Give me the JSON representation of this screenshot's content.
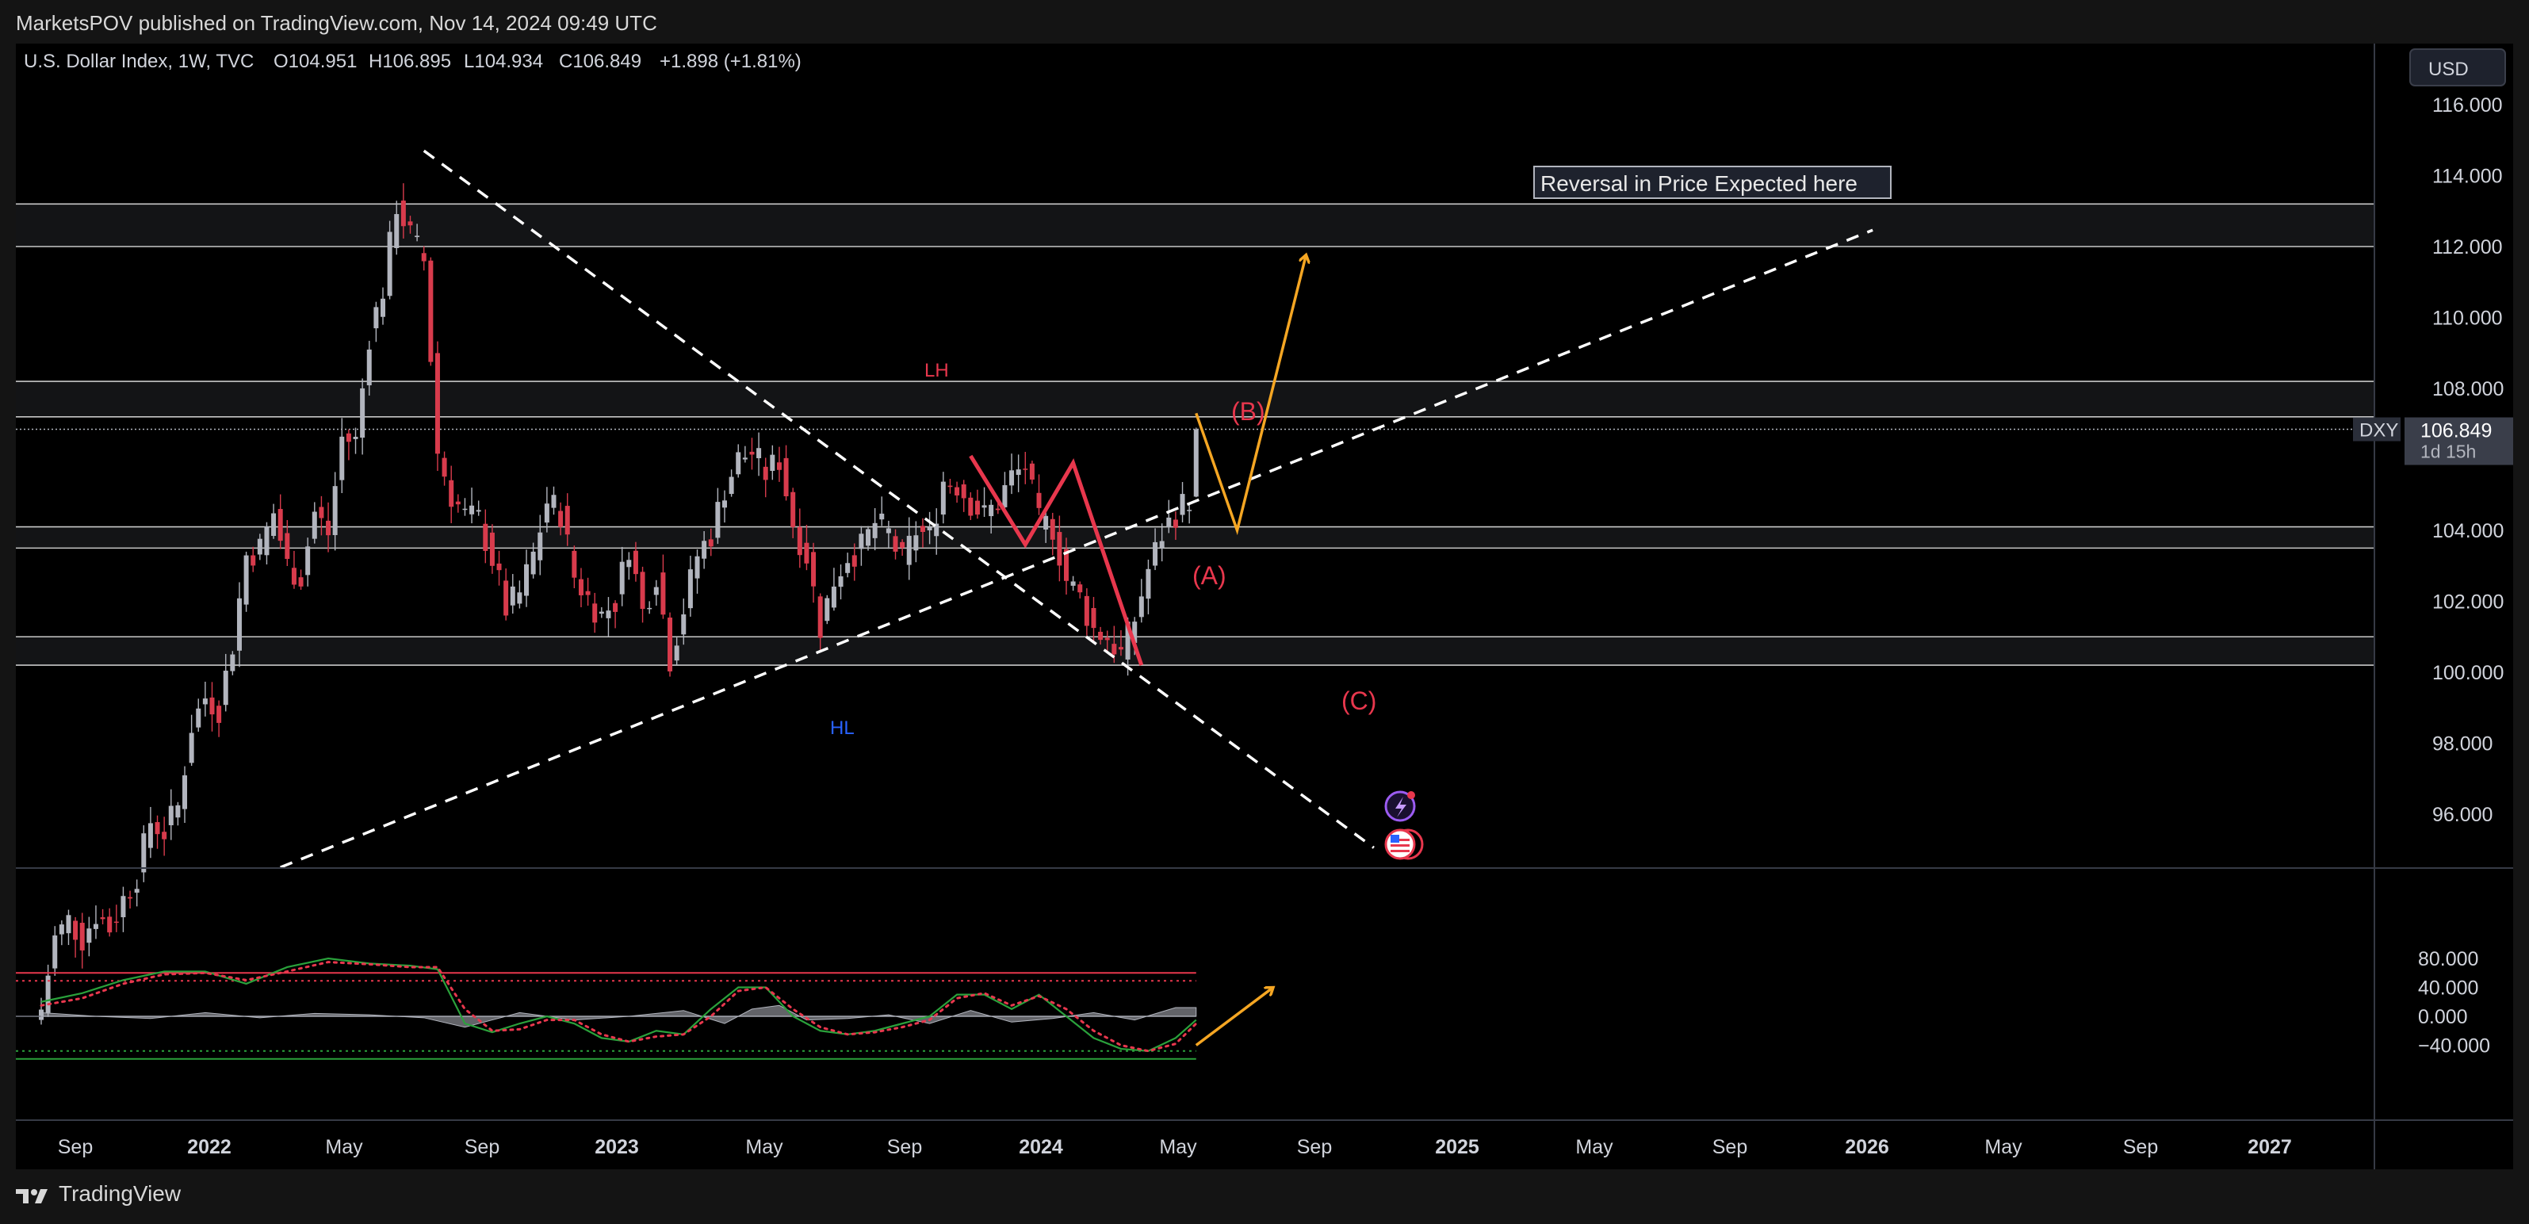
{
  "header": {
    "published": "MarketsPOV published on TradingView.com, Nov 14, 2024 09:49 UTC"
  },
  "legend": {
    "symbol": "U.S. Dollar Index, 1W, TVC",
    "open": "O104.951",
    "high": "H106.895",
    "low": "L104.934",
    "close": "C106.849",
    "change": "+1.898 (+1.81%)"
  },
  "currency": "USD",
  "price_axis": {
    "ticks": [
      "116.000",
      "114.000",
      "112.000",
      "110.000",
      "108.000",
      "104.000",
      "102.000",
      "100.000",
      "98.000",
      "96.000"
    ]
  },
  "price_badge": {
    "ticker": "DXY",
    "price": "106.849",
    "countdown": "1d 15h"
  },
  "osc_axis": {
    "ticks": [
      "80.000",
      "40.000",
      "0.000",
      "−40.000"
    ]
  },
  "time_axis": {
    "labels": [
      "Sep",
      "2022",
      "May",
      "Sep",
      "2023",
      "May",
      "Sep",
      "2024",
      "May",
      "Sep",
      "2025",
      "May",
      "Sep",
      "2026",
      "May",
      "Sep",
      "2027"
    ]
  },
  "annotations": {
    "note": "Reversal in Price Expected here",
    "lh": "LH",
    "hl": "HL",
    "a": "(A)",
    "b": "(B)",
    "c": "(C)"
  },
  "footer": {
    "brand": "TradingView"
  },
  "colors": {
    "bull": "#b2b5be",
    "bear": "#d83b4c",
    "accent": "#f5a623",
    "wave": "#e8374d",
    "trend": "#ffffff"
  },
  "chart_data": {
    "type": "candlestick",
    "title": "U.S. Dollar Index, 1W, TVC",
    "ylim": [
      94.5,
      117
    ],
    "osc_ylim": [
      -52,
      92
    ],
    "close_path": [
      [
        0,
        90.5
      ],
      [
        2,
        92.5
      ],
      [
        4,
        93
      ],
      [
        6,
        92.5
      ],
      [
        8,
        93.2
      ],
      [
        10,
        92.8
      ],
      [
        12,
        93.6
      ],
      [
        14,
        94.3
      ],
      [
        16,
        95.8
      ],
      [
        18,
        95.5
      ],
      [
        20,
        96.2
      ],
      [
        22,
        98.5
      ],
      [
        24,
        99.3
      ],
      [
        26,
        99.0
      ],
      [
        28,
        100.8
      ],
      [
        30,
        103.3
      ],
      [
        32,
        103.5
      ],
      [
        34,
        104.5
      ],
      [
        36,
        103.0
      ],
      [
        38,
        102.7
      ],
      [
        40,
        104.5
      ],
      [
        42,
        103.9
      ],
      [
        44,
        106.6
      ],
      [
        46,
        106.5
      ],
      [
        48,
        109.5
      ],
      [
        50,
        110.8
      ],
      [
        52,
        113.2
      ],
      [
        54,
        112.3
      ],
      [
        56,
        111.6
      ],
      [
        58,
        106.2
      ],
      [
        60,
        105.0
      ],
      [
        62,
        104.4
      ],
      [
        64,
        104.3
      ],
      [
        66,
        103.2
      ],
      [
        68,
        101.8
      ],
      [
        70,
        102.2
      ],
      [
        72,
        103.3
      ],
      [
        74,
        104.8
      ],
      [
        76,
        104.5
      ],
      [
        78,
        102.7
      ],
      [
        80,
        102.1
      ],
      [
        82,
        101.6
      ],
      [
        84,
        102.0
      ],
      [
        86,
        103.6
      ],
      [
        88,
        101.7
      ],
      [
        90,
        102.8
      ],
      [
        92,
        100.4
      ],
      [
        94,
        101.8
      ],
      [
        96,
        103.3
      ],
      [
        98,
        103.9
      ],
      [
        100,
        105.2
      ],
      [
        102,
        106.0
      ],
      [
        104,
        106.2
      ],
      [
        106,
        105.6
      ],
      [
        108,
        106.0
      ],
      [
        110,
        104.2
      ],
      [
        112,
        103.3
      ],
      [
        114,
        101.3
      ],
      [
        116,
        102.6
      ],
      [
        118,
        103.3
      ],
      [
        120,
        103.5
      ],
      [
        122,
        104.2
      ],
      [
        124,
        103.9
      ],
      [
        126,
        103.1
      ],
      [
        128,
        104.0
      ],
      [
        130,
        103.8
      ],
      [
        132,
        105.4
      ],
      [
        134,
        105.3
      ],
      [
        136,
        104.8
      ],
      [
        138,
        104.4
      ],
      [
        140,
        104.8
      ],
      [
        142,
        105.5
      ],
      [
        144,
        105.8
      ],
      [
        146,
        104.2
      ],
      [
        148,
        104.1
      ],
      [
        150,
        102.6
      ],
      [
        152,
        102.1
      ],
      [
        154,
        101.2
      ],
      [
        156,
        101.0
      ],
      [
        158,
        100.5
      ],
      [
        160,
        101.5
      ],
      [
        162,
        102.9
      ],
      [
        164,
        103.9
      ],
      [
        166,
        104.5
      ],
      [
        168,
        104.9
      ],
      [
        169,
        106.849
      ]
    ],
    "zones": [
      [
        112.0,
        113.2
      ],
      [
        107.2,
        108.2
      ],
      [
        103.5,
        104.1
      ],
      [
        100.2,
        101.0
      ]
    ],
    "trendlines": [
      {
        "from": [
          56,
          114.7
        ],
        "to": [
          160,
          100.0
        ],
        "extend_to": 195
      },
      {
        "from": [
          35,
          94.5
        ],
        "to": [
          166,
          104.6
        ],
        "extend_to": 268
      }
    ],
    "current_price": 106.849,
    "ohlc": {
      "open": 104.951,
      "high": 106.895,
      "low": 104.934,
      "close": 106.849,
      "change": 1.898,
      "change_pct": 1.81
    },
    "projection": {
      "arrow": [
        [
          169,
          107.3
        ],
        [
          175,
          104.0
        ],
        [
          185,
          111.7
        ]
      ],
      "osc_arrow": [
        [
          169,
          -40
        ],
        [
          180,
          38
        ]
      ]
    },
    "wave": [
      [
        136,
        106.1
      ],
      [
        144,
        103.6
      ],
      [
        151,
        105.9
      ],
      [
        161,
        100.2
      ]
    ],
    "oscillator": {
      "upper_band": 60,
      "lower_band": -48,
      "fast": [
        [
          0,
          20
        ],
        [
          6,
          32
        ],
        [
          12,
          50
        ],
        [
          18,
          62
        ],
        [
          24,
          62
        ],
        [
          30,
          45
        ],
        [
          36,
          68
        ],
        [
          42,
          80
        ],
        [
          48,
          73
        ],
        [
          54,
          70
        ],
        [
          58,
          65
        ],
        [
          62,
          -10
        ],
        [
          66,
          -22
        ],
        [
          70,
          -10
        ],
        [
          74,
          0
        ],
        [
          78,
          -10
        ],
        [
          82,
          -30
        ],
        [
          86,
          -35
        ],
        [
          90,
          -20
        ],
        [
          94,
          -25
        ],
        [
          98,
          10
        ],
        [
          102,
          40
        ],
        [
          106,
          40
        ],
        [
          110,
          0
        ],
        [
          114,
          -20
        ],
        [
          118,
          -25
        ],
        [
          122,
          -20
        ],
        [
          126,
          -10
        ],
        [
          130,
          0
        ],
        [
          134,
          30
        ],
        [
          138,
          30
        ],
        [
          142,
          10
        ],
        [
          146,
          30
        ],
        [
          150,
          0
        ],
        [
          154,
          -30
        ],
        [
          158,
          -45
        ],
        [
          162,
          -48
        ],
        [
          166,
          -30
        ],
        [
          169,
          -5
        ]
      ],
      "slow": [
        [
          0,
          15
        ],
        [
          6,
          25
        ],
        [
          12,
          45
        ],
        [
          18,
          58
        ],
        [
          24,
          60
        ],
        [
          30,
          50
        ],
        [
          36,
          62
        ],
        [
          42,
          75
        ],
        [
          48,
          72
        ],
        [
          54,
          68
        ],
        [
          58,
          68
        ],
        [
          62,
          10
        ],
        [
          66,
          -20
        ],
        [
          70,
          -18
        ],
        [
          74,
          -5
        ],
        [
          78,
          -5
        ],
        [
          82,
          -25
        ],
        [
          86,
          -35
        ],
        [
          90,
          -28
        ],
        [
          94,
          -25
        ],
        [
          98,
          0
        ],
        [
          102,
          35
        ],
        [
          106,
          40
        ],
        [
          110,
          10
        ],
        [
          114,
          -15
        ],
        [
          118,
          -25
        ],
        [
          122,
          -22
        ],
        [
          126,
          -15
        ],
        [
          130,
          -5
        ],
        [
          134,
          25
        ],
        [
          138,
          32
        ],
        [
          142,
          15
        ],
        [
          146,
          28
        ],
        [
          150,
          10
        ],
        [
          154,
          -20
        ],
        [
          158,
          -40
        ],
        [
          162,
          -48
        ],
        [
          166,
          -38
        ],
        [
          169,
          -10
        ]
      ],
      "histogram": [
        [
          0,
          5
        ],
        [
          8,
          0
        ],
        [
          16,
          -3
        ],
        [
          24,
          5
        ],
        [
          32,
          -2
        ],
        [
          40,
          4
        ],
        [
          48,
          2
        ],
        [
          56,
          -2
        ],
        [
          62,
          -15
        ],
        [
          66,
          -5
        ],
        [
          70,
          5
        ],
        [
          78,
          -5
        ],
        [
          86,
          0
        ],
        [
          94,
          8
        ],
        [
          100,
          -10
        ],
        [
          104,
          10
        ],
        [
          108,
          15
        ],
        [
          112,
          -5
        ],
        [
          118,
          -3
        ],
        [
          124,
          2
        ],
        [
          130,
          -10
        ],
        [
          136,
          8
        ],
        [
          142,
          -8
        ],
        [
          148,
          -3
        ],
        [
          154,
          5
        ],
        [
          160,
          -5
        ],
        [
          166,
          12
        ],
        [
          169,
          12
        ]
      ]
    }
  }
}
